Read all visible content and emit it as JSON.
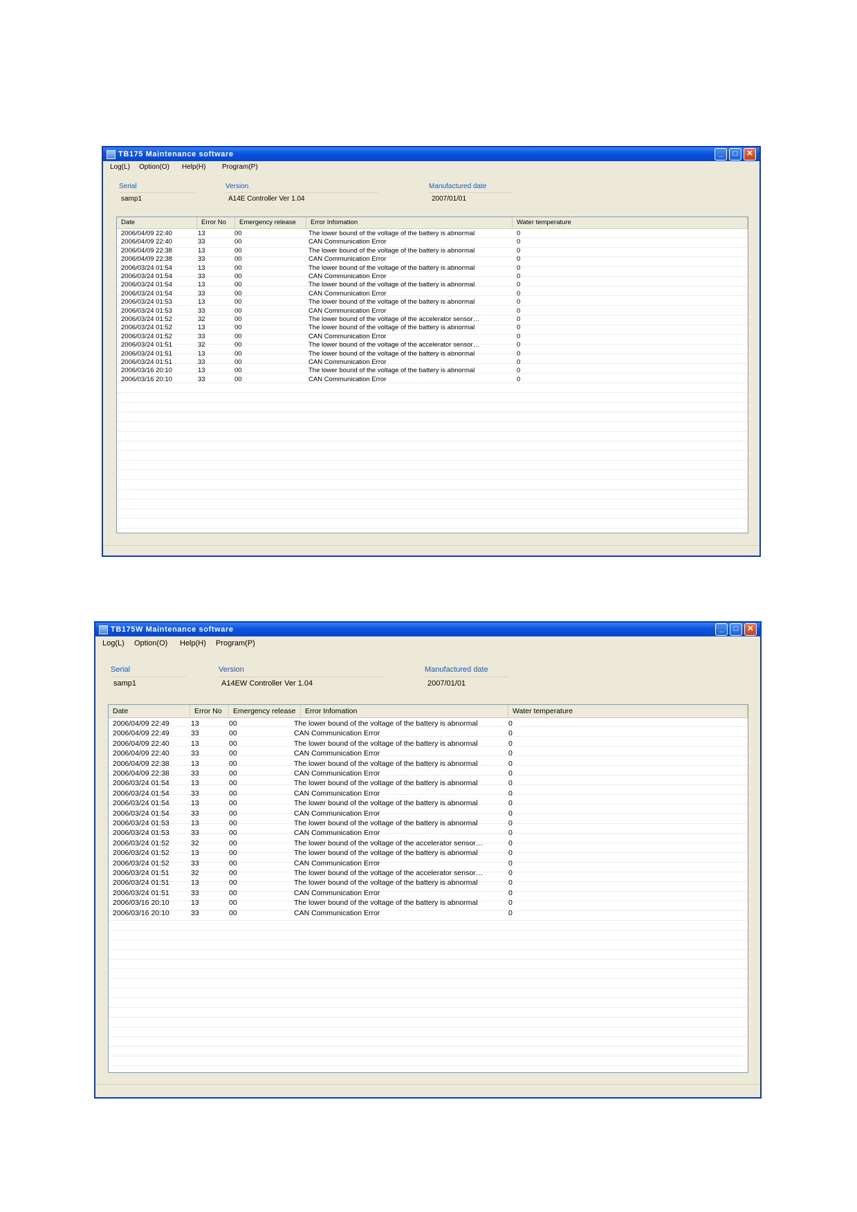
{
  "windows": [
    {
      "title": "TB175 Maintenance software",
      "menu": [
        "Log(L)",
        "Option(O)",
        "Help(H)",
        "Program(P)"
      ],
      "info": {
        "serial_label": "Serial",
        "serial": "samp1",
        "version_label": "Version",
        "version": "A14E Controller  Ver 1.04",
        "mfg_label": "Manufactured date",
        "mfg": "2007/01/01"
      },
      "columns": [
        "Date",
        "Error No",
        "Emergency release",
        "Error Infomation",
        "Water temperature"
      ],
      "rows": [
        [
          "2006/04/09 22:40",
          "13",
          "00",
          "The lower bound of the voltage of the battery is abnormal",
          "0"
        ],
        [
          "2006/04/09 22:40",
          "33",
          "00",
          "CAN Communication Error",
          "0"
        ],
        [
          "2006/04/09 22:38",
          "13",
          "00",
          "The lower bound of the voltage of the battery is abnormal",
          "0"
        ],
        [
          "2006/04/09 22:38",
          "33",
          "00",
          "CAN Communication Error",
          "0"
        ],
        [
          "2006/03/24 01:54",
          "13",
          "00",
          "The lower bound of the voltage of the battery is abnormal",
          "0"
        ],
        [
          "2006/03/24 01:54",
          "33",
          "00",
          "CAN Communication Error",
          "0"
        ],
        [
          "2006/03/24 01:54",
          "13",
          "00",
          "The lower bound of the voltage of the battery is abnormal",
          "0"
        ],
        [
          "2006/03/24 01:54",
          "33",
          "00",
          "CAN Communication Error",
          "0"
        ],
        [
          "2006/03/24 01:53",
          "13",
          "00",
          "The lower bound of the voltage of the battery is abnormal",
          "0"
        ],
        [
          "2006/03/24 01:53",
          "33",
          "00",
          "CAN Communication Error",
          "0"
        ],
        [
          "2006/03/24 01:52",
          "32",
          "00",
          "The lower bound of the voltage of the accelerator sensor…",
          "0"
        ],
        [
          "2006/03/24 01:52",
          "13",
          "00",
          "The lower bound of the voltage of the battery is abnormal",
          "0"
        ],
        [
          "2006/03/24 01:52",
          "33",
          "00",
          "CAN Communication Error",
          "0"
        ],
        [
          "2006/03/24 01:51",
          "32",
          "00",
          "The lower bound of the voltage of the accelerator sensor…",
          "0"
        ],
        [
          "2006/03/24 01:51",
          "13",
          "00",
          "The lower bound of the voltage of the battery is abnormal",
          "0"
        ],
        [
          "2006/03/24 01:51",
          "33",
          "00",
          "CAN Communication Error",
          "0"
        ],
        [
          "2006/03/16 20:10",
          "13",
          "00",
          "The lower bound of the voltage of the battery is abnormal",
          "0"
        ],
        [
          "2006/03/16 20:10",
          "33",
          "00",
          "CAN Communication Error",
          "0"
        ]
      ]
    },
    {
      "title": "TB175W Maintenance software",
      "menu": [
        "Log(L)",
        "Option(O)",
        "Help(H)",
        "Program(P)"
      ],
      "info": {
        "serial_label": "Serial",
        "serial": "samp1",
        "version_label": "Version",
        "version": "A14EW Controller Ver 1.04",
        "mfg_label": "Manufactured date",
        "mfg": "2007/01/01"
      },
      "columns": [
        "Date",
        "Error No",
        "Emergency release",
        "Error Infomation",
        "Water temperature"
      ],
      "rows": [
        [
          "2006/04/09 22:49",
          "13",
          "00",
          "The lower bound of the voltage of the battery is abnormal",
          "0"
        ],
        [
          "2006/04/09 22:49",
          "33",
          "00",
          "CAN Communication Error",
          "0"
        ],
        [
          "2006/04/09 22:40",
          "13",
          "00",
          "The lower bound of the voltage of the battery is abnormal",
          "0"
        ],
        [
          "2006/04/09 22:40",
          "33",
          "00",
          "CAN Communication Error",
          "0"
        ],
        [
          "2006/04/09 22:38",
          "13",
          "00",
          "The lower bound of the voltage of the battery is abnormal",
          "0"
        ],
        [
          "2006/04/09 22:38",
          "33",
          "00",
          "CAN Communication Error",
          "0"
        ],
        [
          "2006/03/24 01:54",
          "13",
          "00",
          "The lower bound of the voltage of the battery is abnormal",
          "0"
        ],
        [
          "2006/03/24 01:54",
          "33",
          "00",
          "CAN Communication Error",
          "0"
        ],
        [
          "2006/03/24 01:54",
          "13",
          "00",
          "The lower bound of the voltage of the battery is abnormal",
          "0"
        ],
        [
          "2006/03/24 01:54",
          "33",
          "00",
          "CAN Communication Error",
          "0"
        ],
        [
          "2006/03/24 01:53",
          "13",
          "00",
          "The lower bound of the voltage of the battery is abnormal",
          "0"
        ],
        [
          "2006/03/24 01:53",
          "33",
          "00",
          "CAN Communication Error",
          "0"
        ],
        [
          "2006/03/24 01:52",
          "32",
          "00",
          "The lower bound of the voltage of the accelerator sensor…",
          "0"
        ],
        [
          "2006/03/24 01:52",
          "13",
          "00",
          "The lower bound of the voltage of the battery is abnormal",
          "0"
        ],
        [
          "2006/03/24 01:52",
          "33",
          "00",
          "CAN Communication Error",
          "0"
        ],
        [
          "2006/03/24 01:51",
          "32",
          "00",
          "The lower bound of the voltage of the accelerator sensor…",
          "0"
        ],
        [
          "2006/03/24 01:51",
          "13",
          "00",
          "The lower bound of the voltage of the battery is abnormal",
          "0"
        ],
        [
          "2006/03/24 01:51",
          "33",
          "00",
          "CAN Communication Error",
          "0"
        ],
        [
          "2006/03/16 20:10",
          "13",
          "00",
          "The lower bound of the voltage of the battery is abnormal",
          "0"
        ],
        [
          "2006/03/16 20:10",
          "33",
          "00",
          "CAN Communication Error",
          "0"
        ]
      ]
    }
  ],
  "icons": {
    "app": "app-icon",
    "minimize": "minimize-icon",
    "maximize": "maximize-icon",
    "close": "close-icon"
  },
  "colors": {
    "titlebar": "#0a55e0",
    "window_bg": "#ece9d8",
    "label_blue": "#1d5bbf",
    "close_button": "#c6401c"
  }
}
